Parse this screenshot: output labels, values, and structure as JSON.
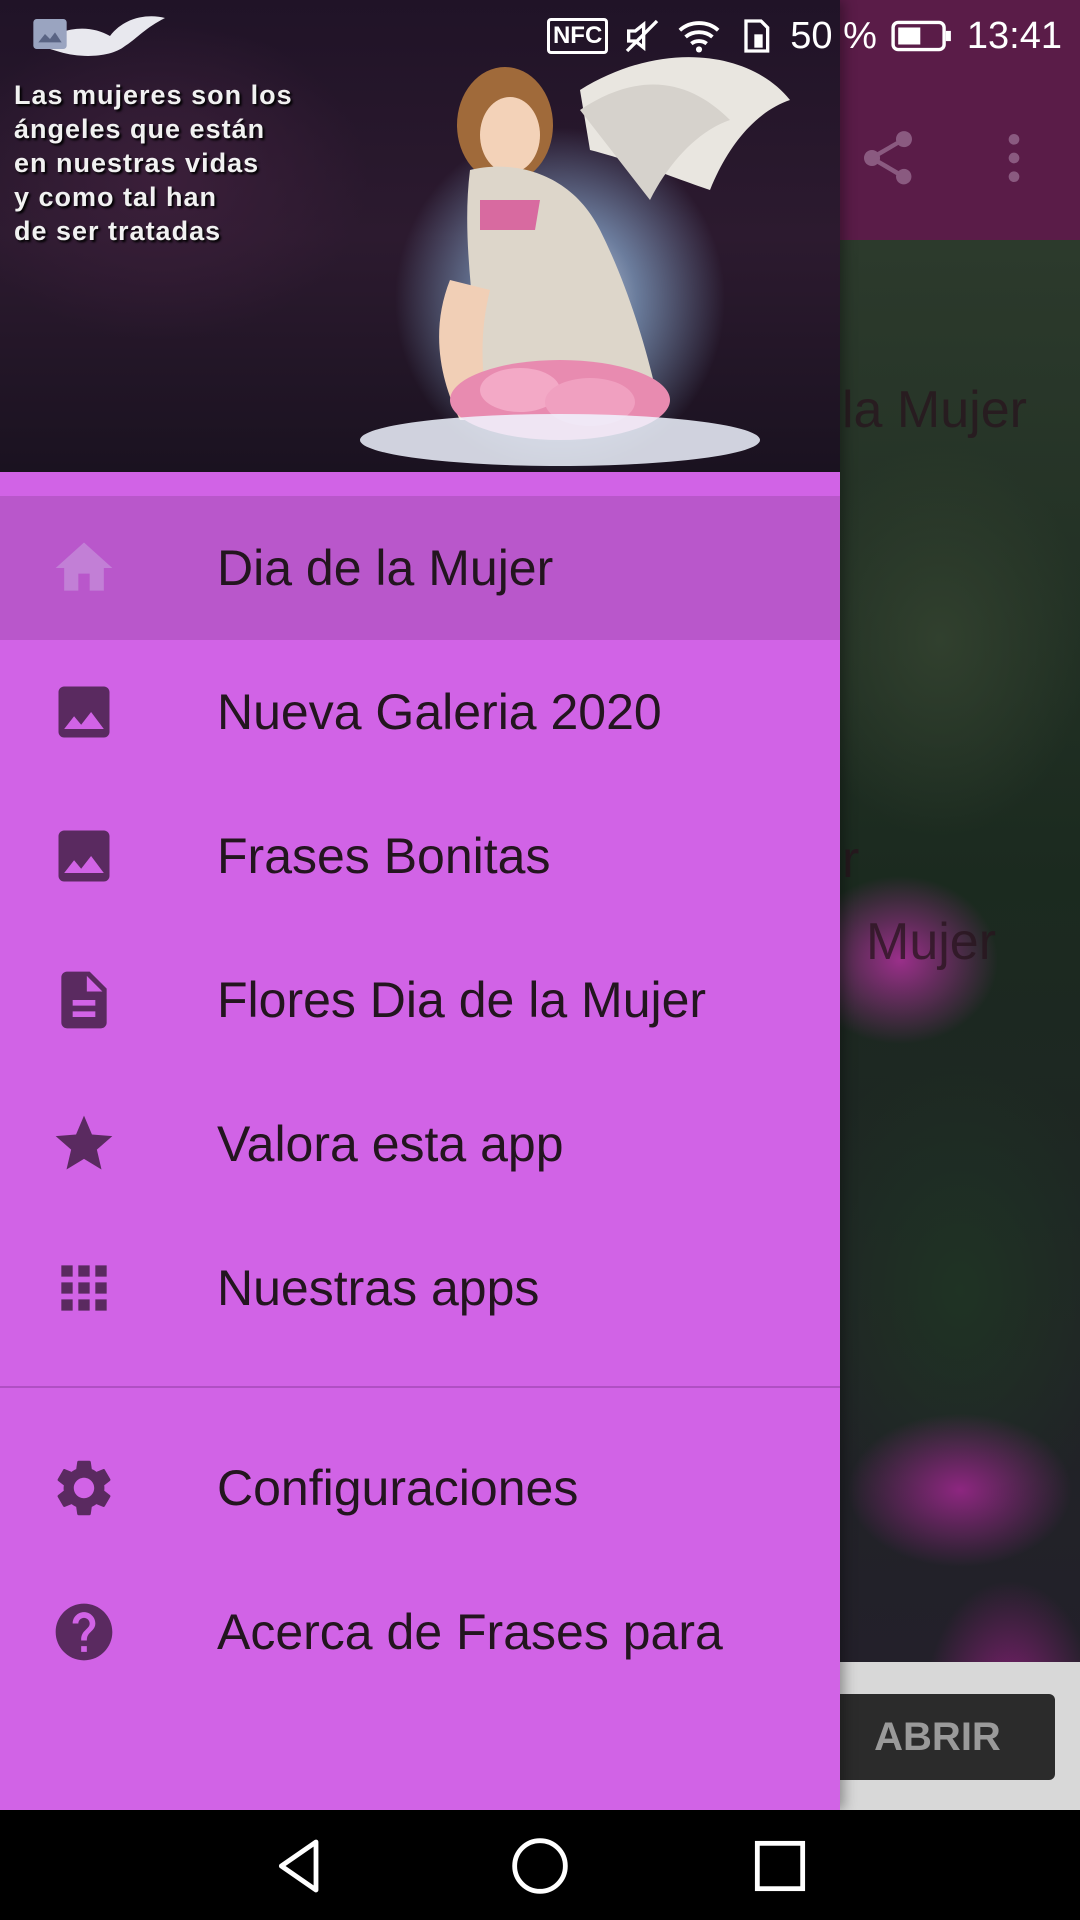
{
  "status_bar": {
    "nfc": "NFC",
    "battery": "50 %",
    "time": "13:41"
  },
  "background": {
    "text_1": "la Mujer",
    "text_2": "r",
    "text_3": "Mujer",
    "open_button_label": "ABRIR"
  },
  "drawer": {
    "header_quote": "Las mujeres son los\nángeles que están\nen nuestras vidas\ny como tal han\nde ser tratadas",
    "items": [
      {
        "label": "Dia de la Mujer",
        "icon": "home-icon",
        "selected": true
      },
      {
        "label": "Nueva Galeria 2020",
        "icon": "image-icon",
        "selected": false
      },
      {
        "label": "Frases Bonitas",
        "icon": "image-icon",
        "selected": false
      },
      {
        "label": "Flores Dia de la Mujer",
        "icon": "document-icon",
        "selected": false
      },
      {
        "label": "Valora esta app",
        "icon": "star-icon",
        "selected": false
      },
      {
        "label": "Nuestras apps",
        "icon": "apps-grid-icon",
        "selected": false
      }
    ],
    "secondary_items": [
      {
        "label": "Configuraciones",
        "icon": "gear-icon"
      },
      {
        "label": "Acerca de Frases para",
        "icon": "help-icon"
      }
    ]
  },
  "colors": {
    "drawer_bg": "#d163e6",
    "selected_bg": "#b957cb",
    "icon_color": "#5a2a60",
    "toolbar_bg": "#5a1c48"
  }
}
